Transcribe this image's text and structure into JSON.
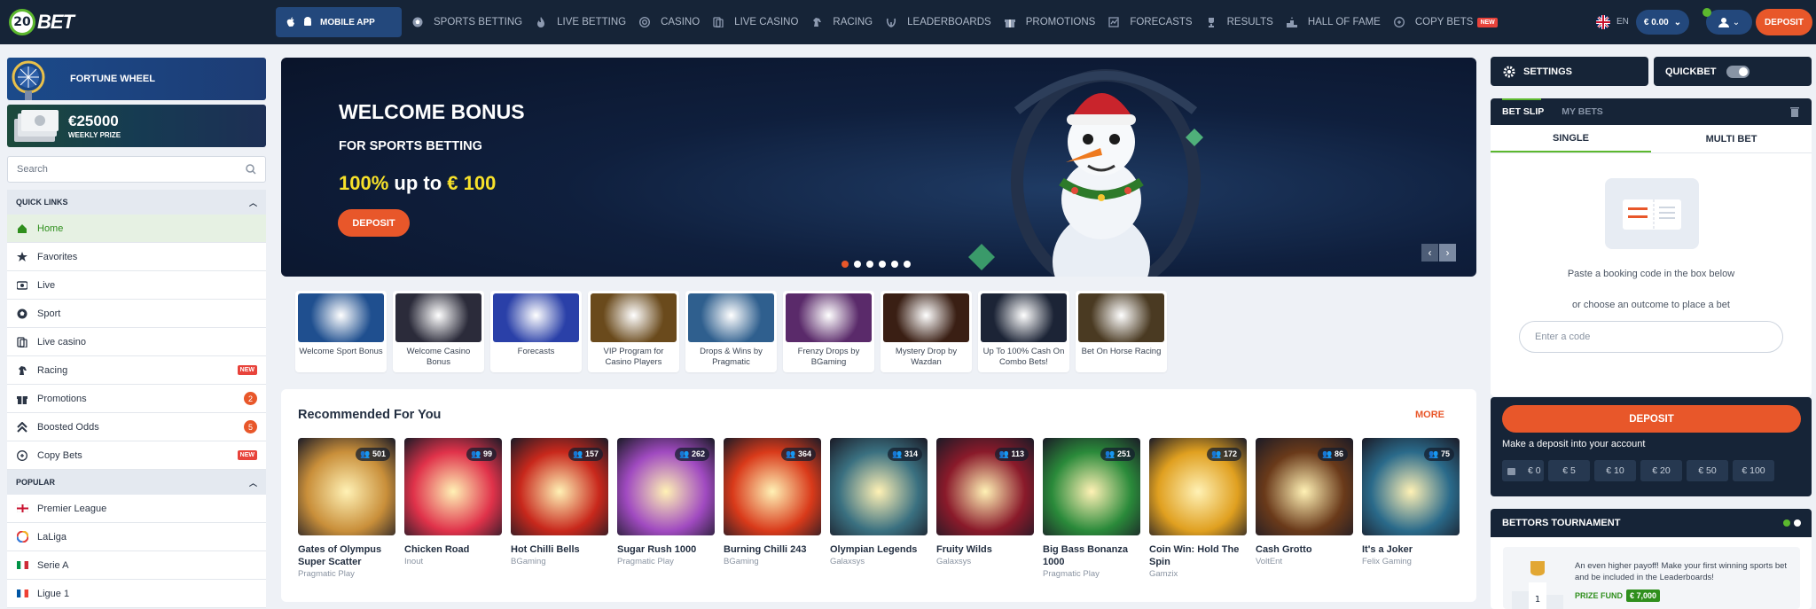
{
  "header": {
    "logo": "20BET",
    "mobile_app": "MOBILE APP",
    "nav": [
      {
        "label": "SPORTS BETTING",
        "icon": "soccer-ball-icon"
      },
      {
        "label": "LIVE BETTING",
        "icon": "flame-icon"
      },
      {
        "label": "CASINO",
        "icon": "chip-icon"
      },
      {
        "label": "LIVE CASINO",
        "icon": "cards-icon"
      },
      {
        "label": "RACING",
        "icon": "horse-icon"
      },
      {
        "label": "LEADERBOARDS",
        "icon": "laurel-icon"
      },
      {
        "label": "PROMOTIONS",
        "icon": "gift-icon"
      },
      {
        "label": "FORECASTS",
        "icon": "chart-icon"
      },
      {
        "label": "RESULTS",
        "icon": "trophy-icon"
      },
      {
        "label": "HALL OF FAME",
        "icon": "podium-icon"
      },
      {
        "label": "COPY BETS",
        "icon": "copy-icon",
        "badge": "NEW"
      }
    ],
    "lang": "EN",
    "balance": "€ 0.00",
    "deposit": "DEPOSIT"
  },
  "sidebar": {
    "fortune_wheel": "FORTUNE WHEEL",
    "weekly_amount": "€25000",
    "weekly_label": "WEEKLY PRIZE",
    "search_placeholder": "Search",
    "quick_links_title": "QUICK LINKS",
    "quick_links": [
      {
        "label": "Home",
        "icon": "home-icon",
        "active": true
      },
      {
        "label": "Favorites",
        "icon": "star-icon"
      },
      {
        "label": "Live",
        "icon": "live-icon"
      },
      {
        "label": "Sport",
        "icon": "soccer-ball-icon"
      },
      {
        "label": "Live casino",
        "icon": "cards-icon"
      },
      {
        "label": "Racing",
        "icon": "horse-icon",
        "badge": "NEW"
      },
      {
        "label": "Promotions",
        "icon": "gift-icon",
        "count": "2"
      },
      {
        "label": "Boosted Odds",
        "icon": "boost-icon",
        "count": "5"
      },
      {
        "label": "Copy Bets",
        "icon": "copy-icon",
        "badge": "NEW"
      }
    ],
    "popular_title": "POPULAR",
    "popular": [
      {
        "label": "Premier League",
        "icon": "england-flag-icon"
      },
      {
        "label": "LaLiga",
        "icon": "laliga-icon"
      },
      {
        "label": "Serie A",
        "icon": "italy-flag-icon"
      },
      {
        "label": "Ligue 1",
        "icon": "france-flag-icon"
      }
    ]
  },
  "hero": {
    "title": "WELCOME BONUS",
    "subtitle": "FOR SPORTS BETTING",
    "offer_pct": "100%",
    "offer_mid": " up to ",
    "offer_amt": "€ 100",
    "button": "DEPOSIT",
    "slides": 6,
    "active_slide": 0
  },
  "promo_cards": [
    {
      "label": "Welcome Sport Bonus",
      "color": "#1f4f8f"
    },
    {
      "label": "Welcome Casino Bonus",
      "color": "#2b2b3a"
    },
    {
      "label": "Forecasts",
      "color": "#2a40a8"
    },
    {
      "label": "VIP Program for Casino Players",
      "color": "#6a4a1c"
    },
    {
      "label": "Drops & Wins by Pragmatic",
      "color": "#2f5f8e"
    },
    {
      "label": "Frenzy Drops by BGaming",
      "color": "#5a2a6a"
    },
    {
      "label": "Mystery Drop by Wazdan",
      "color": "#3a1f14"
    },
    {
      "label": "Up To 100% Cash On Combo Bets!",
      "color": "#1c2436"
    },
    {
      "label": "Bet On Horse Racing",
      "color": "#4a3a22"
    }
  ],
  "recommended": {
    "title": "Recommended For You",
    "more": "MORE",
    "games": [
      {
        "name": "Gates of Olympus Super Scatter",
        "provider": "Pragmatic Play",
        "players": "501",
        "color": "#c98f3a"
      },
      {
        "name": "Chicken Road",
        "provider": "Inout",
        "players": "99",
        "color": "#e0324a"
      },
      {
        "name": "Hot Chilli Bells",
        "provider": "BGaming",
        "players": "157",
        "color": "#c8281c"
      },
      {
        "name": "Sugar Rush 1000",
        "provider": "Pragmatic Play",
        "players": "262",
        "color": "#a04ac0"
      },
      {
        "name": "Burning Chilli 243",
        "provider": "BGaming",
        "players": "364",
        "color": "#d93a1a"
      },
      {
        "name": "Olympian Legends",
        "provider": "Galaxsys",
        "players": "314",
        "color": "#3a7080"
      },
      {
        "name": "Fruity Wilds",
        "provider": "Galaxsys",
        "players": "113",
        "color": "#8a1a2a"
      },
      {
        "name": "Big Bass Bonanza 1000",
        "provider": "Pragmatic Play",
        "players": "251",
        "color": "#2a8a3a"
      },
      {
        "name": "Coin Win: Hold The Spin",
        "provider": "Gamzix",
        "players": "172",
        "color": "#e0a020"
      },
      {
        "name": "Cash Grotto",
        "provider": "VoltEnt",
        "players": "86",
        "color": "#6a3a1a"
      },
      {
        "name": "It's a Joker",
        "provider": "Felix Gaming",
        "players": "75",
        "color": "#2a6a8a"
      }
    ]
  },
  "betslip": {
    "settings": "SETTINGS",
    "quickbet": "QUICKBET",
    "tab_betslip": "BET SLIP",
    "tab_mybets": "MY BETS",
    "single": "SINGLE",
    "multi": "MULTI BET",
    "paste_text": "Paste a booking code in the box below",
    "choose_text": "or choose an outcome to place a bet",
    "code_placeholder": "Enter a code"
  },
  "deposit_box": {
    "button": "DEPOSIT",
    "text": "Make a deposit into your account",
    "amounts": [
      "€ 0",
      "€ 5",
      "€ 10",
      "€ 20",
      "€ 50",
      "€ 100"
    ]
  },
  "tournament": {
    "title": "BETTORS TOURNAMENT",
    "text": "An even higher payoff! Make your first winning sports bet and be included in the Leaderboards!",
    "fund_label": "PRIZE FUND",
    "fund_value": "€ 7,000"
  },
  "colors": {
    "accent": "#e8572a",
    "header": "#162437",
    "green": "#5cb82e"
  }
}
